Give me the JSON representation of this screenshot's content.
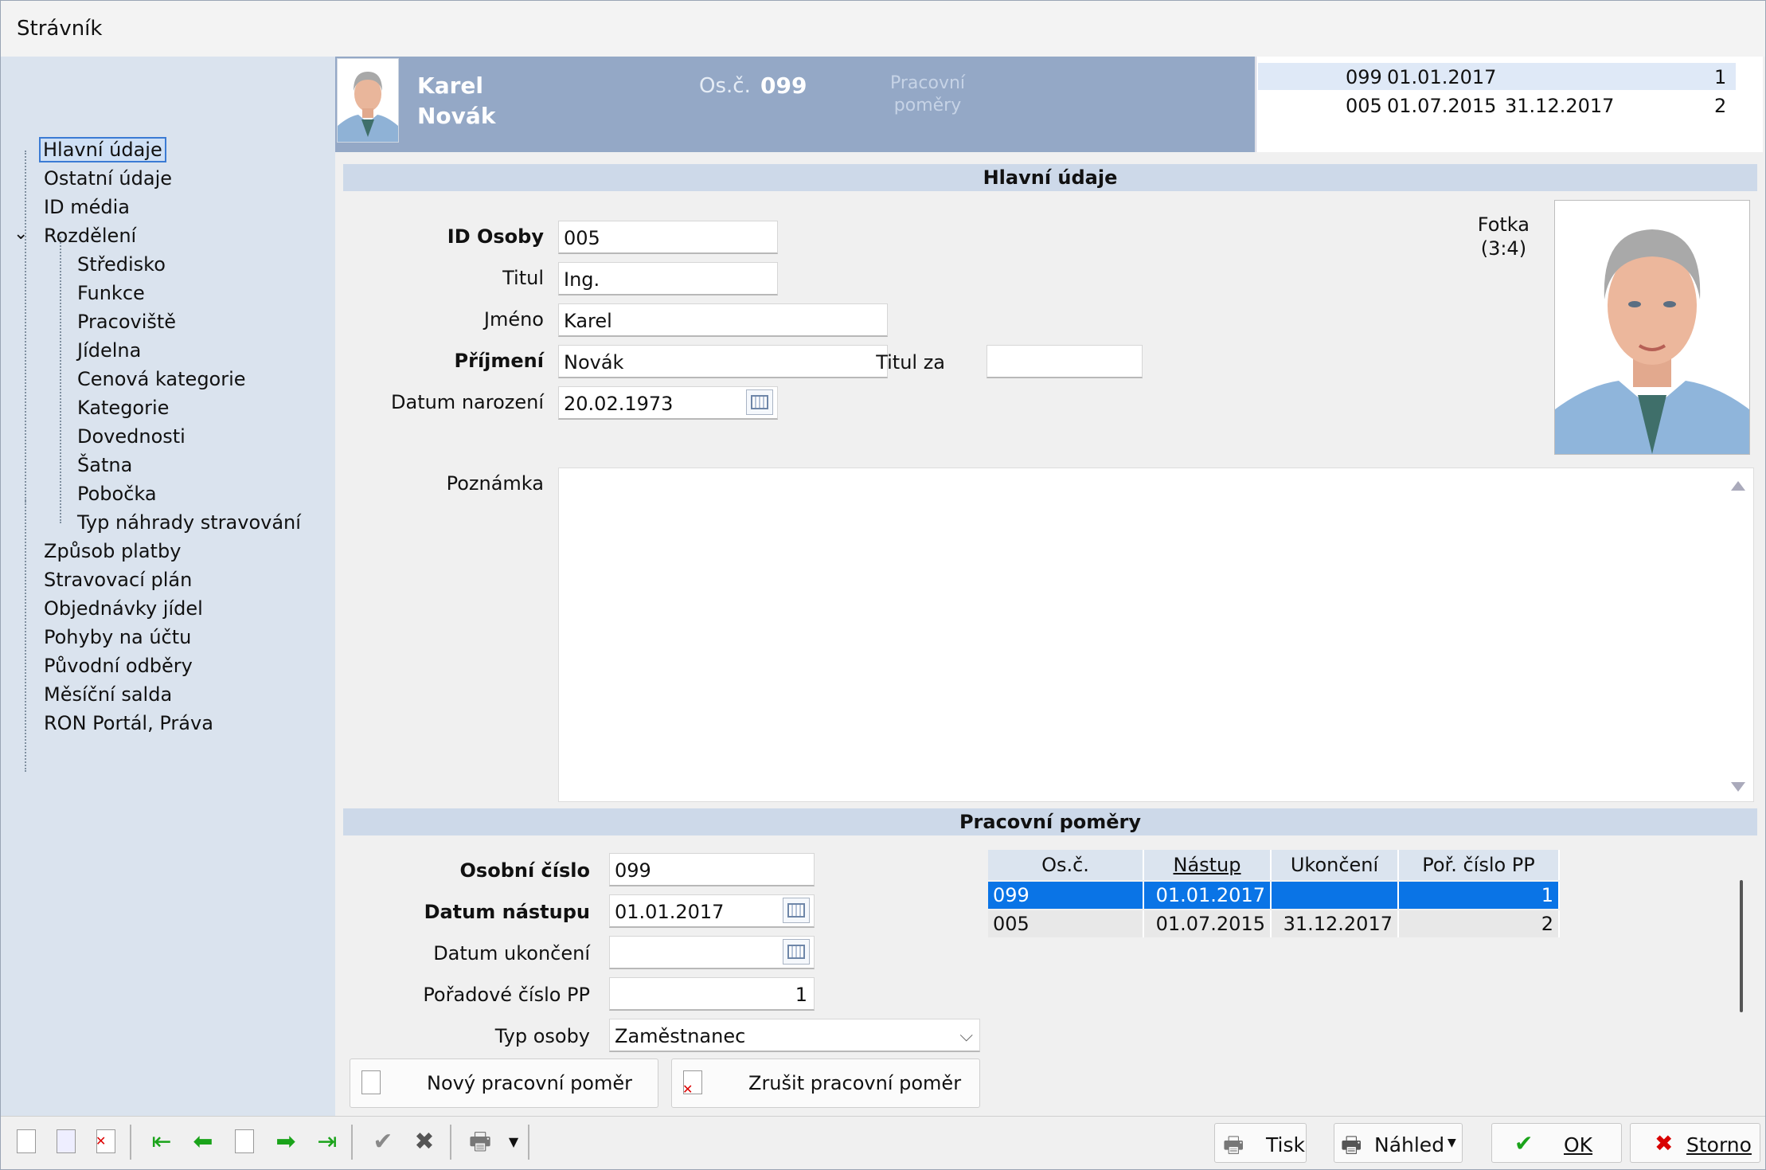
{
  "window": {
    "title": "Strávník"
  },
  "tree": {
    "items": [
      "Hlavní údaje",
      "Ostatní údaje",
      "ID média",
      "Rozdělení",
      "Středisko",
      "Funkce",
      "Pracoviště",
      "Jídelna",
      "Cenová kategorie",
      "Kategorie",
      "Dovednosti",
      "Šatna",
      "Pobočka",
      "Typ náhrady stravování",
      "Způsob platby",
      "Stravovací plán",
      "Objednávky jídel",
      "Pohyby na účtu",
      "Původní odběry",
      "Měsíční salda",
      "RON Portál, Práva"
    ],
    "selected": "Hlavní údaje"
  },
  "header": {
    "first_name": "Karel",
    "last_name": "Novák",
    "os_label": "Os.č.",
    "os_value": "099",
    "pp_label_1": "Pracovní",
    "pp_label_2": "poměry",
    "list": [
      {
        "os": "099",
        "start": "01.01.2017",
        "end": "",
        "no": "1"
      },
      {
        "os": "005",
        "start": "01.07.2015",
        "end": "31.12.2017",
        "no": "2"
      }
    ]
  },
  "main": {
    "section_title": "Hlavní údaje",
    "id_label": "ID Osoby",
    "id_value": "005",
    "title_label": "Titul",
    "title_value": "Ing.",
    "firstname_label": "Jméno",
    "firstname_value": "Karel",
    "lastname_label": "Příjmení",
    "lastname_value": "Novák",
    "title_after_label": "Titul za",
    "title_after_value": "",
    "birth_label": "Datum narození",
    "birth_value": "20.02.1973",
    "photo_label_1": "Fotka",
    "photo_label_2": "(3:4)",
    "note_label": "Poznámka",
    "note_value": ""
  },
  "employment": {
    "section_title": "Pracovní poměry",
    "os_label": "Osobní číslo",
    "os_value": "099",
    "start_label": "Datum nástupu",
    "start_value": "01.01.2017",
    "end_label": "Datum ukončení",
    "end_value": "",
    "order_label": "Pořadové číslo PP",
    "order_value": "1",
    "type_label": "Typ osoby",
    "type_value": "Zaměstnanec",
    "new_button": "Nový pracovní poměr",
    "cancel_button": "Zrušit pracovní poměr",
    "columns": [
      "Os.č.",
      "Nástup",
      "Ukončení",
      "Poř. číslo PP"
    ],
    "rows": [
      {
        "os": "099",
        "start": "01.01.2017",
        "end": "",
        "no": "1"
      },
      {
        "os": "005",
        "start": "01.07.2015",
        "end": "31.12.2017",
        "no": "2"
      }
    ]
  },
  "toolbar": {
    "print": "Tisk",
    "preview": "Náhled",
    "ok": "OK",
    "cancel": "Storno"
  },
  "colors": {
    "header_bg": "#94a8c6",
    "tree_bg": "#dae3ee",
    "section_bg": "#cdd9e9",
    "selection": "#0a74e6"
  }
}
